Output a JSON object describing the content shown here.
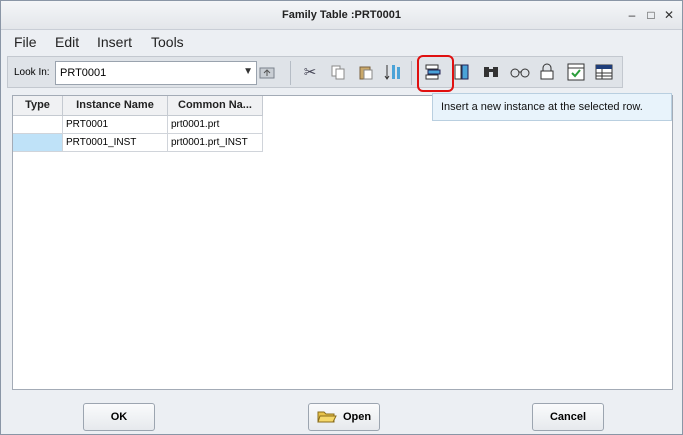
{
  "window": {
    "title": "Family Table :PRT0001"
  },
  "menu": [
    "File",
    "Edit",
    "Insert",
    "Tools"
  ],
  "toolbar": {
    "look_in_label": "Look In:",
    "look_in_value": "PRT0001"
  },
  "tooltip": "Insert a new instance at the selected row.",
  "table": {
    "headers": [
      "Type",
      "Instance Name",
      "Common Na..."
    ],
    "rows": [
      {
        "type": "",
        "instance": "PRT0001",
        "common": "prt0001.prt"
      },
      {
        "type": "",
        "instance": "PRT0001_INST",
        "common": "prt0001.prt_INST"
      }
    ]
  },
  "buttons": {
    "ok": "OK",
    "open": "Open",
    "cancel": "Cancel"
  },
  "colors": {
    "highlight": "#e01010",
    "selected_cell": "#bfe2f8",
    "tooltip_bg": "#e8f3fb"
  }
}
